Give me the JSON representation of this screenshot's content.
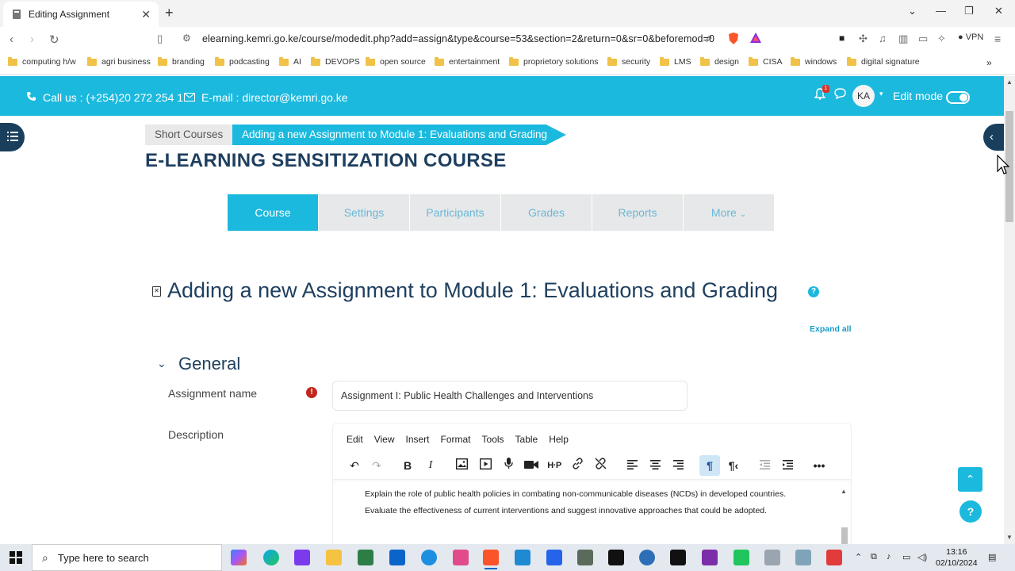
{
  "browser": {
    "tab_title": "Editing Assignment",
    "url": "elearning.kemri.go.ke/course/modedit.php?add=assign&type&course=53&section=2&return=0&sr=0&beforemod=0",
    "vpn_label": "VPN",
    "bookmarks": [
      "computing h/w",
      "agri business",
      "branding",
      "podcasting",
      "AI",
      "DEVOPS",
      "open source",
      "entertainment",
      "proprietory solutions",
      "security",
      "LMS",
      "design",
      "CISA",
      "windows",
      "digital signature"
    ]
  },
  "topbar": {
    "phone": "Call us : (+254)20 272 254 1",
    "email": "E-mail : director@kemri.go.ke",
    "notification_count": "1",
    "user_initials": "KA",
    "edit_mode_label": "Edit mode",
    "edit_mode_on": true,
    "accent_color": "#1cb9de"
  },
  "breadcrumb": {
    "items": [
      "Short Courses",
      "Adding a new Assignment to Module 1: Evaluations and Grading"
    ]
  },
  "course_title": "E-LEARNING SENSITIZATION COURSE",
  "course_nav": {
    "tabs": [
      "Course",
      "Settings",
      "Participants",
      "Grades",
      "Reports",
      "More"
    ],
    "active": "Course"
  },
  "page": {
    "heading": "Adding a new Assignment to Module 1: Evaluations and Grading",
    "expand_all": "Expand all"
  },
  "general": {
    "section_title": "General",
    "assignment_name_label": "Assignment name",
    "assignment_name_value": "Assignment I:  Public Health Challenges and Interventions",
    "description_label": "Description",
    "editor_menu": [
      "Edit",
      "View",
      "Insert",
      "Format",
      "Tools",
      "Table",
      "Help"
    ],
    "description_lines": [
      "Explain the role of public health policies in combating non-communicable diseases (NCDs) in developed countries.",
      "Evaluate the effectiveness of current interventions and suggest innovative approaches that could be adopted."
    ]
  },
  "taskbar": {
    "search_placeholder": "Type here to search",
    "time": "13:16",
    "date": "02/10/2024"
  }
}
